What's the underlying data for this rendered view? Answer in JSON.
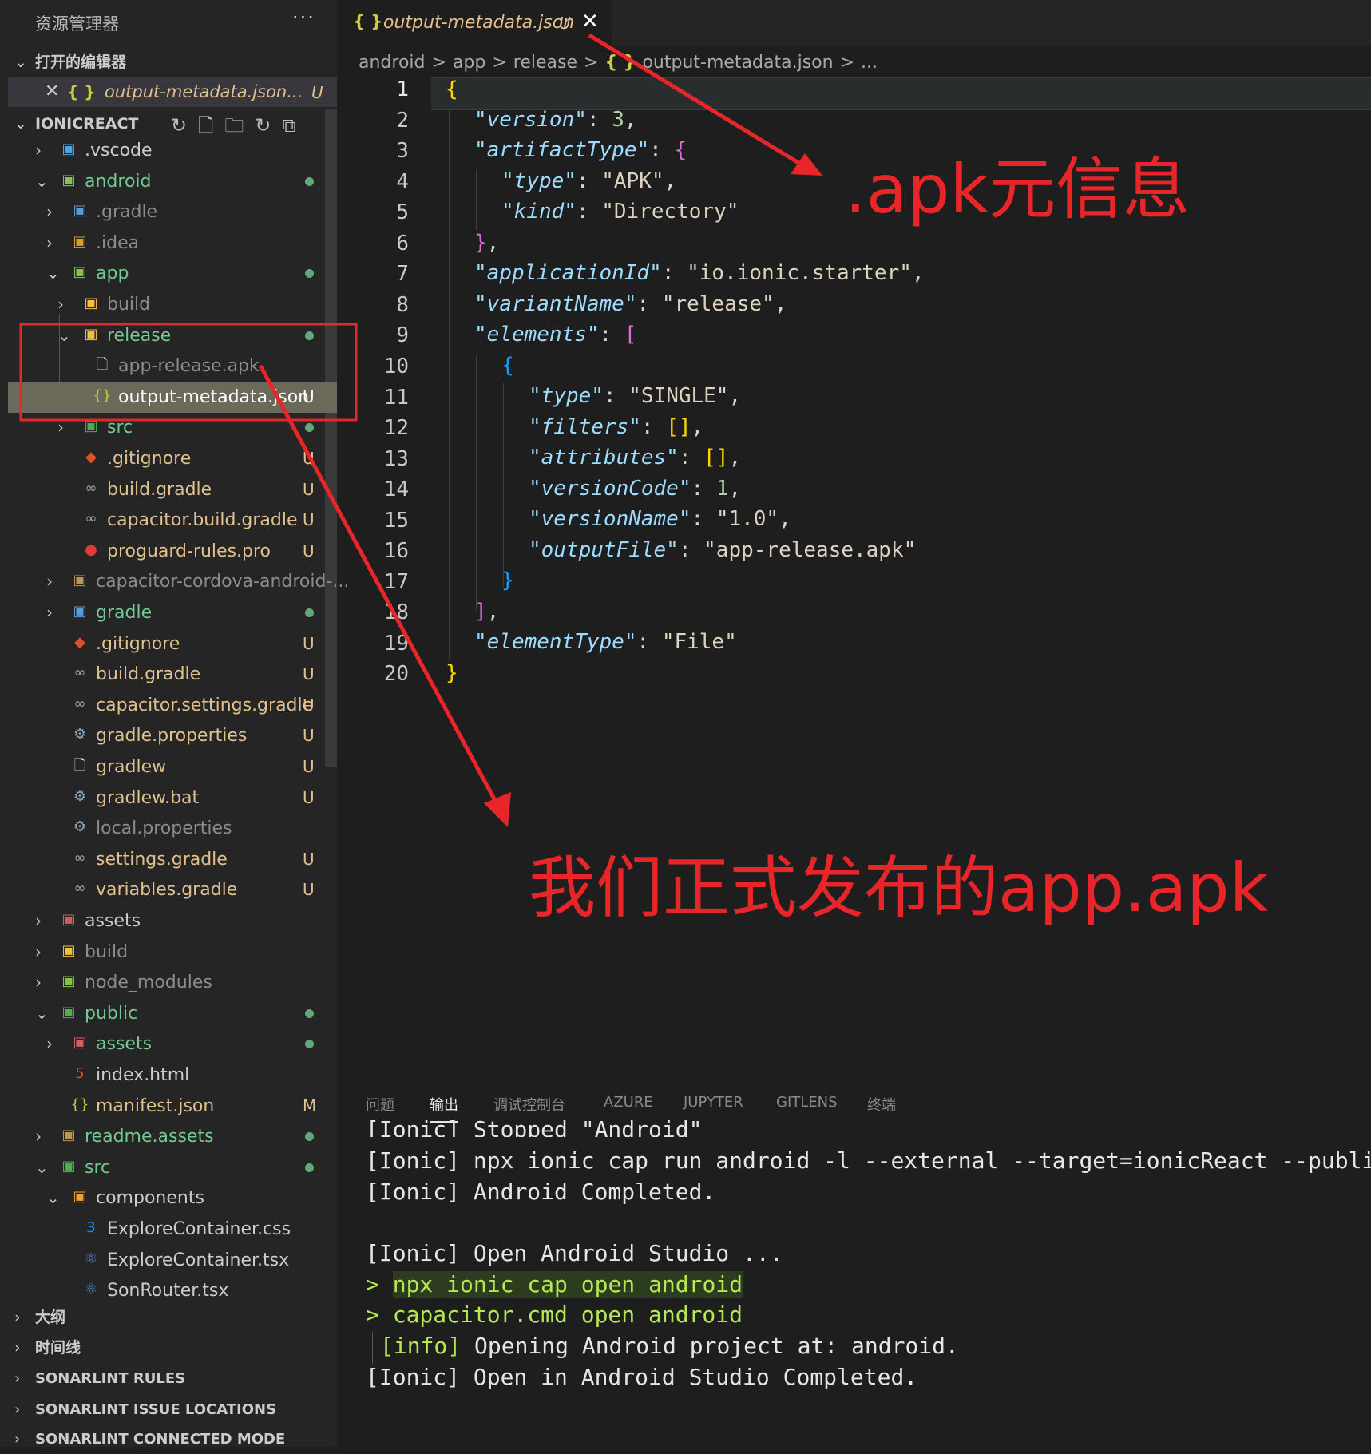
{
  "sidebar": {
    "title": "资源管理器",
    "more": "···",
    "sections": {
      "open_editors": "打开的编辑器",
      "project": "IONICREACT",
      "outline": "大纲",
      "timeline": "时间线",
      "sonar_rules": "SONARLINT RULES",
      "sonar_issue": "SONARLINT ISSUE LOCATIONS",
      "sonar_connected": "SONARLINT CONNECTED MODE"
    },
    "open_editor": {
      "name": "output-metadata.json...",
      "status": "U"
    },
    "tree": [
      {
        "label": "vscode",
        "display": ".vscode",
        "status": "",
        "dot": false
      },
      {
        "display": "android",
        "status": "",
        "dot": true
      },
      {
        "display": ".gradle",
        "status": "",
        "dot": false
      },
      {
        "display": ".idea",
        "status": "",
        "dot": false
      },
      {
        "display": "app",
        "status": "",
        "dot": true
      },
      {
        "display": "build",
        "status": "",
        "dot": false
      },
      {
        "display": "release",
        "status": "",
        "dot": true
      },
      {
        "display": "app-release.apk",
        "status": "",
        "dot": false
      },
      {
        "display": "output-metadata.json",
        "status": "U",
        "dot": false
      },
      {
        "display": "src",
        "status": "",
        "dot": true
      },
      {
        "display": ".gitignore",
        "status": "U",
        "dot": false
      },
      {
        "display": "build.gradle",
        "status": "U",
        "dot": false
      },
      {
        "display": "capacitor.build.gradle",
        "status": "U",
        "dot": false
      },
      {
        "display": "proguard-rules.pro",
        "status": "U",
        "dot": false
      },
      {
        "display": "capacitor-cordova-android-...",
        "status": "",
        "dot": false
      },
      {
        "display": "gradle",
        "status": "",
        "dot": true
      },
      {
        "display": ".gitignore",
        "status": "U",
        "dot": false
      },
      {
        "display": "build.gradle",
        "status": "U",
        "dot": false
      },
      {
        "display": "capacitor.settings.gradle",
        "status": "U",
        "dot": false
      },
      {
        "display": "gradle.properties",
        "status": "U",
        "dot": false
      },
      {
        "display": "gradlew",
        "status": "U",
        "dot": false
      },
      {
        "display": "gradlew.bat",
        "status": "U",
        "dot": false
      },
      {
        "display": "local.properties",
        "status": "",
        "dot": false
      },
      {
        "display": "settings.gradle",
        "status": "U",
        "dot": false
      },
      {
        "display": "variables.gradle",
        "status": "U",
        "dot": false
      },
      {
        "display": "assets",
        "status": "",
        "dot": false
      },
      {
        "display": "build",
        "status": "",
        "dot": false
      },
      {
        "display": "node_modules",
        "status": "",
        "dot": false
      },
      {
        "display": "public",
        "status": "",
        "dot": true
      },
      {
        "display": "assets",
        "status": "",
        "dot": true
      },
      {
        "display": "index.html",
        "status": "",
        "dot": false
      },
      {
        "display": "manifest.json",
        "status": "M",
        "dot": false
      },
      {
        "display": "readme.assets",
        "status": "",
        "dot": true
      },
      {
        "display": "src",
        "status": "",
        "dot": true
      },
      {
        "display": "components",
        "status": "",
        "dot": false
      },
      {
        "display": "ExploreContainer.css",
        "status": "",
        "dot": false
      },
      {
        "display": "ExploreContainer.tsx",
        "status": "",
        "dot": false
      },
      {
        "display": "SonRouter.tsx",
        "status": "",
        "dot": false
      }
    ]
  },
  "editor": {
    "tab": {
      "name": "output-metadata.json",
      "status": "U"
    },
    "breadcrumb": [
      "android",
      ">",
      "app",
      ">",
      "release",
      ">",
      "{ }",
      "output-metadata.json",
      ">",
      "..."
    ],
    "line_numbers": [
      "1",
      "2",
      "3",
      "4",
      "5",
      "6",
      "7",
      "8",
      "9",
      "10",
      "11",
      "12",
      "13",
      "14",
      "15",
      "16",
      "17",
      "18",
      "19",
      "20"
    ],
    "tokens": {
      "version": "\"version\"",
      "three": "3",
      "artifactType": "\"artifactType\"",
      "type": "\"type\"",
      "apk": "\"APK\"",
      "kind": "\"kind\"",
      "directory": "\"Directory\"",
      "applicationId": "\"applicationId\"",
      "appid": "\"io.ionic.starter\"",
      "variantName": "\"variantName\"",
      "release": "\"release\"",
      "elements": "\"elements\"",
      "single": "\"SINGLE\"",
      "filters": "\"filters\"",
      "attributes": "\"attributes\"",
      "versionCode": "\"versionCode\"",
      "one": "1",
      "versionName": "\"versionName\"",
      "ver": "\"1.0\"",
      "outputFile": "\"outputFile\"",
      "file": "\"app-release.apk\"",
      "elementType": "\"elementType\"",
      "fileType": "\"File\""
    }
  },
  "panel": {
    "tabs": [
      "问题",
      "输出",
      "调试控制台",
      "AZURE",
      "JUPYTER",
      "GITLENS",
      "终端"
    ],
    "active_tab": "输出",
    "lines": [
      "[Ionic] Stopped \"Android\"",
      "[Ionic] npx ionic cap run android -l --external --target=ionicReact --publi",
      "[Ionic] Android Completed.",
      "",
      "[Ionic] Open Android Studio ...",
      "> npx ionic cap open android",
      "> capacitor.cmd open android",
      "[info] Opening Android project at: android.",
      "[Ionic] Open in Android Studio Completed."
    ]
  },
  "annotations": {
    "apk_meta": ".apk元信息",
    "release_apk": "我们正式发布的app.apk",
    "color": "#e8262a"
  },
  "colors": {
    "accent": "#73c991",
    "untracked": "#e2c08d",
    "json_key": "#9cdcfe"
  }
}
